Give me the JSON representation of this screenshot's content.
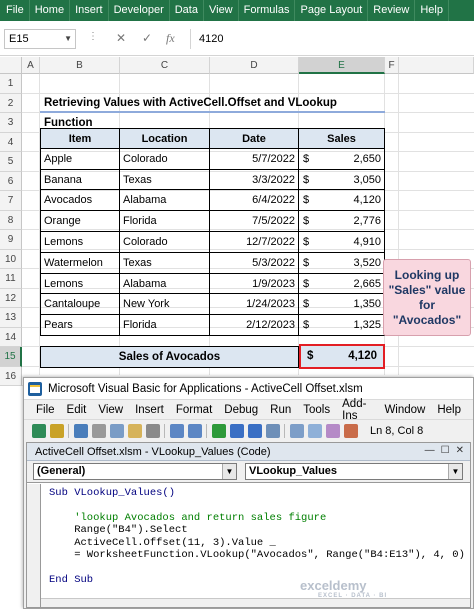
{
  "ribbon": {
    "tabs": [
      "File",
      "Home",
      "Insert",
      "Developer",
      "Data",
      "View",
      "Formulas",
      "Page Layout",
      "Review",
      "Help"
    ]
  },
  "formula_bar": {
    "name_box": "E15",
    "cancel_symbol": "✕",
    "enter_symbol": "✓",
    "fx_symbol": "fx",
    "value": "4120"
  },
  "grid": {
    "columns": [
      "A",
      "B",
      "C",
      "D",
      "E",
      "F"
    ],
    "selected_column": "E",
    "rows": [
      "1",
      "2",
      "3",
      "4",
      "5",
      "6",
      "7",
      "8",
      "9",
      "10",
      "11",
      "12",
      "13",
      "14",
      "15",
      "16"
    ],
    "selected_row": "15"
  },
  "sheet": {
    "title": "Retrieving Values with ActiveCell.Offset and VLookup Function",
    "headers": [
      "Item",
      "Location",
      "Date",
      "Sales"
    ],
    "currency_symbol": "$",
    "rows": [
      {
        "item": "Apple",
        "location": "Colorado",
        "date": "5/7/2022",
        "sales": "2,650"
      },
      {
        "item": "Banana",
        "location": "Texas",
        "date": "3/3/2022",
        "sales": "3,050"
      },
      {
        "item": "Avocados",
        "location": "Alabama",
        "date": "6/4/2022",
        "sales": "4,120"
      },
      {
        "item": "Orange",
        "location": "Florida",
        "date": "7/5/2022",
        "sales": "2,776"
      },
      {
        "item": "Lemons",
        "location": "Colorado",
        "date": "12/7/2022",
        "sales": "4,910"
      },
      {
        "item": "Watermelon",
        "location": "Texas",
        "date": "5/3/2022",
        "sales": "3,520"
      },
      {
        "item": "Lemons",
        "location": "Alabama",
        "date": "1/9/2023",
        "sales": "2,665"
      },
      {
        "item": "Cantaloupe",
        "location": "New York",
        "date": "1/24/2023",
        "sales": "1,350"
      },
      {
        "item": "Pears",
        "location": "Florida",
        "date": "2/12/2023",
        "sales": "1,325"
      }
    ],
    "summary_label": "Sales of Avocados",
    "summary_value": "4,120",
    "callout": "Looking up \"Sales\" value for \"Avocados\""
  },
  "vba": {
    "window_title": "Microsoft Visual Basic for Applications - ActiveCell Offset.xlsm",
    "menu": [
      "File",
      "Edit",
      "View",
      "Insert",
      "Format",
      "Debug",
      "Run",
      "Tools",
      "Add-Ins",
      "Window",
      "Help"
    ],
    "status": "Ln 8, Col 8",
    "code_window_title": "ActiveCell Offset.xlsm - VLookup_Values (Code)",
    "object_combo": "(General)",
    "procedure_combo": "VLookup_Values",
    "code_lines": [
      "Sub VLookup_Values()",
      "",
      "    'lookup Avocados and return sales figure",
      "    Range(\"B4\").Select",
      "    ActiveCell.Offset(11, 3).Value _",
      "    = WorksheetFunction.VLookup(\"Avocados\", Range(\"B4:E13\"), 4, 0)",
      "",
      "End Sub"
    ]
  },
  "watermark": {
    "name": "exceldemy",
    "tagline": "EXCEL · DATA · BI"
  },
  "colors": {
    "excel_green": "#217346",
    "header_fill": "#dce6f1",
    "highlight_border": "#e31e24",
    "callout_fill": "#f9d7df"
  }
}
